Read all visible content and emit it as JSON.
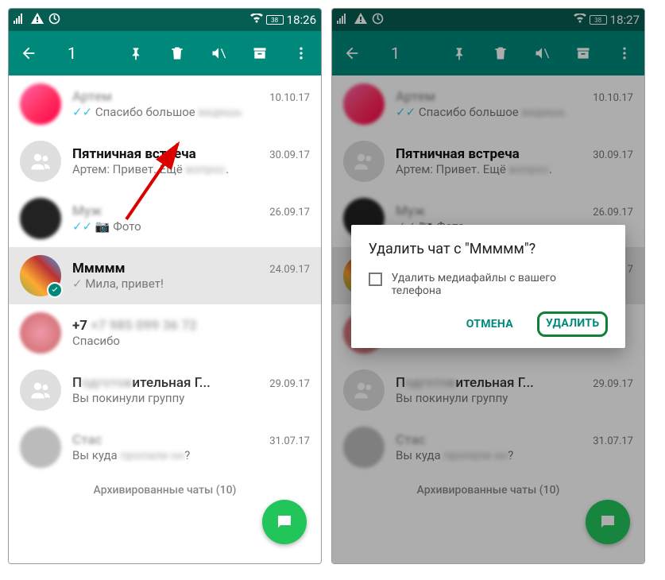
{
  "statusbar": {
    "battery": "38",
    "time_left": "18:26",
    "time_right": "18:27"
  },
  "appbar": {
    "count": "1"
  },
  "chats": [
    {
      "name": "Артем",
      "date": "10.10.17",
      "sub": "Спасибо большое",
      "ticks": true,
      "blurred_name": true,
      "avatar_color": "linear-gradient(135deg,#f66,#f06)"
    },
    {
      "name": "Пятничная встреча",
      "date": "30.09.17",
      "sub": "Артем: Привет. Ещё",
      "group": true,
      "bold": true
    },
    {
      "name": "Муж",
      "date": "26.09.17",
      "sub": "Фото",
      "ticks": true,
      "camera": true,
      "blurred_name": true,
      "avatar_color": "#222"
    },
    {
      "name": "Ммммм",
      "date": "24.09.17",
      "sub": "Мила, привет!",
      "selected": true,
      "bold": true,
      "sent_tick": true,
      "avatar_color": "linear-gradient(45deg,#a52,#8b3,#fa3)"
    },
    {
      "name": "+7 985 099 36 72",
      "date": "",
      "sub": "Спасибо",
      "blurred_name": true,
      "avatar_color": "radial-gradient(#e8a,#c66)"
    },
    {
      "name": "Подготовительная Г...",
      "date": "29.09.17",
      "sub": "Вы покинули группу",
      "group": true,
      "blurred_name": true
    },
    {
      "name": "Стас",
      "date": "31.07.17",
      "sub": "Вы куда",
      "sub_suffix": "?",
      "blurred_name": true,
      "avatar_color": "#aaa"
    }
  ],
  "archived": "Архивированные чаты (10)",
  "dialog": {
    "title": "Удалить чат с \"Ммммм\"?",
    "check_label": "Удалить медиафайлы с вашего телефона",
    "cancel": "ОТМЕНА",
    "confirm": "УДАЛИТЬ"
  }
}
